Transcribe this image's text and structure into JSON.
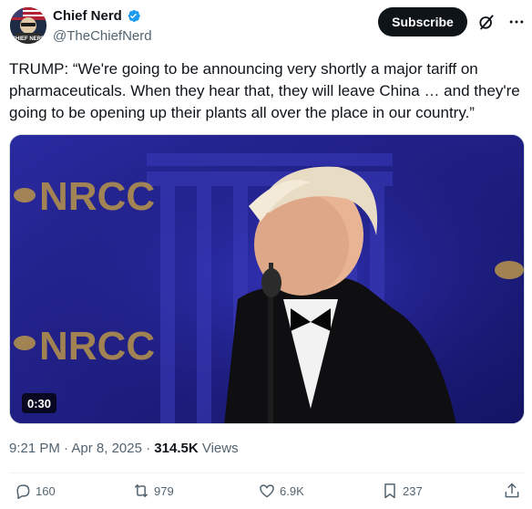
{
  "author": {
    "display_name": "Chief Nerd",
    "handle": "@TheChiefNerd",
    "verified": true,
    "avatar_text": "CHIEF NERD"
  },
  "header": {
    "subscribe_label": "Subscribe",
    "grok_icon": "grok-icon",
    "more_icon": "more-dots-icon"
  },
  "tweet": {
    "text": "TRUMP: “We're going to be announcing very shortly a major tariff on pharmaceuticals. When they hear that, they will leave China … and they're going to be opening up their plants all over the place in our country.”"
  },
  "media": {
    "duration": "0:30",
    "backdrop_text_top": "NRCC",
    "backdrop_text_bottom": "NRCC",
    "colors": {
      "backdrop": "#1f1f8c",
      "logo_gold": "#b8944a"
    }
  },
  "meta": {
    "time": "9:21 PM",
    "separator": "·",
    "date": "Apr 8, 2025",
    "views_count": "314.5K",
    "views_label": "Views"
  },
  "actions": {
    "reply_count": "160",
    "retweet_count": "979",
    "like_count": "6.9K",
    "bookmark_count": "237"
  },
  "colors": {
    "text_primary": "#0f1419",
    "text_secondary": "#536471",
    "verified_blue": "#1d9bf0"
  }
}
